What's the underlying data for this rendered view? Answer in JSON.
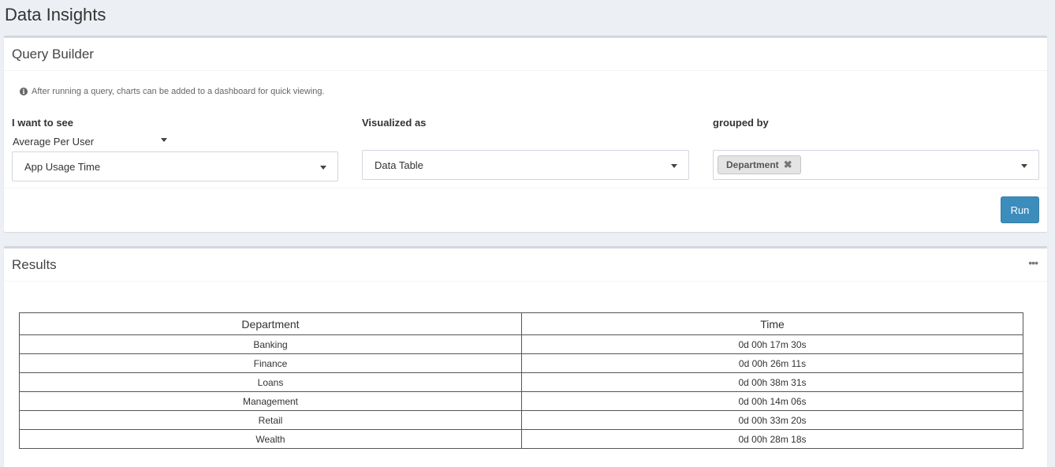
{
  "page": {
    "title": "Data Insights"
  },
  "query_builder": {
    "title": "Query Builder",
    "info_text": "After running a query, charts can be added to a dashboard for quick viewing.",
    "metric": {
      "label": "I want to see",
      "aggregation": "Average Per User",
      "value": "App Usage Time"
    },
    "visualization": {
      "label": "Visualized as",
      "value": "Data Table"
    },
    "grouping": {
      "label": "grouped by",
      "tags": [
        "Department"
      ]
    },
    "run_label": "Run"
  },
  "results": {
    "title": "Results",
    "menu_icon": "•••",
    "columns": [
      "Department",
      "Time"
    ],
    "rows": [
      [
        "Banking",
        "0d 00h 17m 30s"
      ],
      [
        "Finance",
        "0d 00h 26m 11s"
      ],
      [
        "Loans",
        "0d 00h 38m 31s"
      ],
      [
        "Management",
        "0d 00h 14m 06s"
      ],
      [
        "Retail",
        "0d 00h 33m 20s"
      ],
      [
        "Wealth",
        "0d 00h 28m 18s"
      ]
    ]
  },
  "icons": {
    "info": "info-circle-icon",
    "caret": "caret-down-icon",
    "remove": "times-icon",
    "menu": "ellipsis-icon"
  },
  "colors": {
    "run_button": "#3c8dbc",
    "background": "#ecf0f5"
  }
}
